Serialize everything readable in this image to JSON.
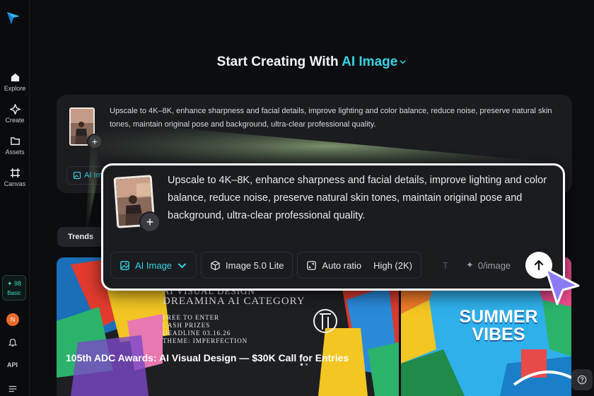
{
  "sidebar": {
    "items": [
      {
        "label": "Explore",
        "icon": "home-icon"
      },
      {
        "label": "Create",
        "icon": "sparkle-icon"
      },
      {
        "label": "Assets",
        "icon": "folder-icon"
      },
      {
        "label": "Canvas",
        "icon": "canvas-icon"
      }
    ],
    "credits": {
      "count": "98",
      "plan": "Basic"
    },
    "avatar_initial": "N",
    "api_label": "API"
  },
  "heading": {
    "prefix": "Start Creating With",
    "accent": "AI Image"
  },
  "prompt": {
    "text": "Upscale to 4K–8K, enhance sharpness and facial details, improve lighting and color balance, reduce noise, preserve natural skin tones, maintain original pose and background, ultra-clear professional quality.",
    "add_symbol": "+"
  },
  "background_card": {
    "mode_chip": "AI Im"
  },
  "toolbar": {
    "mode_label": "AI Image",
    "model_label": "Image 5.0 Lite",
    "ratio_label": "Auto ratio",
    "quality_label": "High (2K)",
    "faded_glyph": "T",
    "cost_label": "0/image"
  },
  "tabs": {
    "trends_label": "Trends"
  },
  "gallery": {
    "tiles": [
      {
        "caption": "105th ADC Awards: AI Visual Design — $30K Call for Entries",
        "poster_lines": [
          "AI VISUAL DESIGN",
          "DREAMINA AI CATEGORY",
          "FREE TO ENTER",
          "CASH PRIZES",
          "DEADLINE 03.16.26",
          "THEME: IMPERFECTION"
        ]
      },
      {
        "poster_title": "SUMMER VIBES"
      }
    ]
  },
  "colors": {
    "accent": "#36d3e6",
    "background": "#0c0d10",
    "card": "#1b1c20",
    "cursor": "#8b7cf6"
  }
}
